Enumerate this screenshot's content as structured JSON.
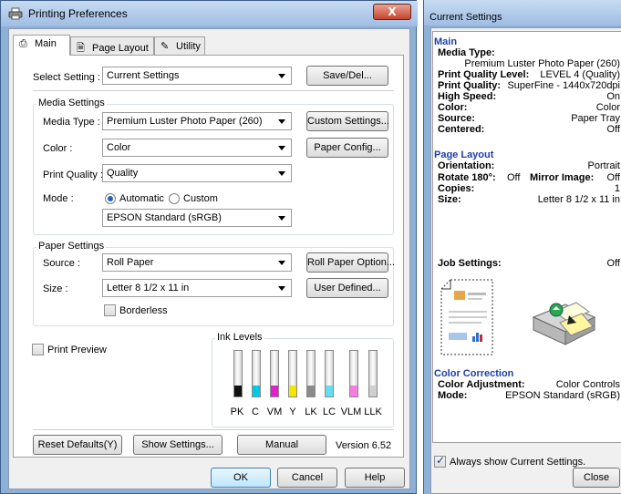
{
  "dialog": {
    "title": "Printing Preferences",
    "close_label": "X",
    "tabs": [
      {
        "label": "Main",
        "icon": "printer-icon"
      },
      {
        "label": "Page Layout",
        "icon": "page-icon"
      },
      {
        "label": "Utility",
        "icon": "wrench-icon"
      }
    ],
    "select_setting": {
      "label": "Select Setting :",
      "value": "Current Settings",
      "save_label": "Save/Del..."
    },
    "media_settings": {
      "title": "Media Settings",
      "media_type_label": "Media Type :",
      "media_type_value": "Premium Luster Photo Paper (260)",
      "custom_settings_label": "Custom Settings...",
      "color_label": "Color :",
      "color_value": "Color",
      "paper_config_label": "Paper Config...",
      "print_quality_label": "Print Quality :",
      "print_quality_value": "Quality",
      "mode_label": "Mode :",
      "mode_automatic": "Automatic",
      "mode_custom": "Custom",
      "mode_selected": "Automatic",
      "mode_value": "EPSON Standard (sRGB)"
    },
    "paper_settings": {
      "title": "Paper Settings",
      "source_label": "Source :",
      "source_value": "Roll Paper",
      "roll_paper_option_label": "Roll Paper Option...",
      "size_label": "Size :",
      "size_value": "Letter 8 1/2 x 11 in",
      "user_defined_label": "User Defined...",
      "borderless_label": "Borderless",
      "borderless_checked": false
    },
    "print_preview": {
      "label": "Print Preview",
      "checked": false
    },
    "ink_levels": {
      "title": "Ink Levels",
      "inks": [
        {
          "name": "PK",
          "color": "#111111",
          "level": 0.25
        },
        {
          "name": "C",
          "color": "#00c8e6",
          "level": 0.25
        },
        {
          "name": "VM",
          "color": "#e020c8",
          "level": 0.25
        },
        {
          "name": "Y",
          "color": "#f2e600",
          "level": 0.25
        },
        {
          "name": "LK",
          "color": "#8a8a8a",
          "level": 0.25
        },
        {
          "name": "LC",
          "color": "#66ddee",
          "level": 0.25
        },
        {
          "name": "VLM",
          "color": "#f27ee0",
          "level": 0.25
        },
        {
          "name": "LLK",
          "color": "#cfcfcf",
          "level": 0.25
        }
      ]
    },
    "footer": {
      "reset_defaults_label": "Reset Defaults(Y)",
      "show_settings_label": "Show Settings...",
      "manual_label": "Manual",
      "version": "Version 6.52"
    },
    "buttons": {
      "ok": "OK",
      "cancel": "Cancel",
      "help": "Help"
    }
  },
  "current_settings": {
    "title": "Current Settings",
    "main": {
      "heading": "Main",
      "media_type_label": "Media Type:",
      "media_type_value": "Premium Luster Photo Paper (260)",
      "print_quality_level_label": "Print Quality Level:",
      "print_quality_level_value": "LEVEL 4 (Quality)",
      "print_quality_label": "Print Quality:",
      "print_quality_value": "SuperFine - 1440x720dpi",
      "high_speed_label": "High Speed:",
      "high_speed_value": "On",
      "color_label": "Color:",
      "color_value": "Color",
      "source_label": "Source:",
      "source_value": "Paper Tray",
      "centered_label": "Centered:",
      "centered_value": "Off"
    },
    "page_layout": {
      "heading": "Page Layout",
      "orientation_label": "Orientation:",
      "orientation_value": "Portrait",
      "rotate_label": "Rotate 180°:",
      "rotate_value": "Off",
      "mirror_label": "Mirror Image:",
      "mirror_value": "Off",
      "copies_label": "Copies:",
      "copies_value": "1",
      "size_label": "Size:",
      "size_value": "Letter 8 1/2 x 11 in"
    },
    "job_settings_label": "Job Settings:",
    "job_settings_value": "Off",
    "color_correction": {
      "heading": "Color Correction",
      "adjustment_label": "Color Adjustment:",
      "adjustment_value": "Color Controls",
      "mode_label": "Mode:",
      "mode_value": "EPSON Standard (sRGB)"
    },
    "always_show_label": "Always show Current Settings.",
    "always_show_checked": true,
    "close_label": "Close"
  }
}
